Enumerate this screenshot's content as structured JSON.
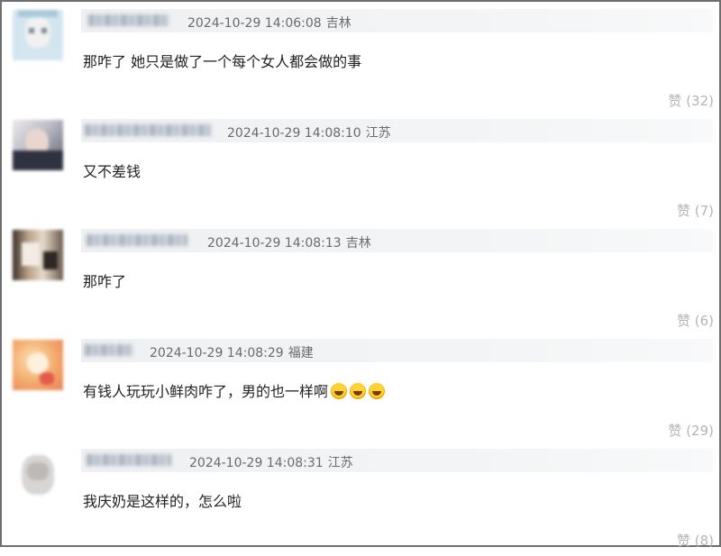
{
  "comments": [
    {
      "timestamp": "2024-10-29 14:06:08",
      "location": "吉林",
      "text": "那咋了 她只是做了一个每个女人都会做的事",
      "like_label": "赞",
      "like_count": "(32)",
      "emoji": []
    },
    {
      "timestamp": "2024-10-29 14:08:10",
      "location": "江苏",
      "text": "又不差钱",
      "like_label": "赞",
      "like_count": "(7)",
      "emoji": []
    },
    {
      "timestamp": "2024-10-29 14:08:13",
      "location": "吉林",
      "text": "那咋了",
      "like_label": "赞",
      "like_count": "(6)",
      "emoji": []
    },
    {
      "timestamp": "2024-10-29 14:08:29",
      "location": "福建",
      "text": "有钱人玩玩小鲜肉咋了，男的也一样啊",
      "like_label": "赞",
      "like_count": "(29)",
      "emoji": [
        "rolling-on-floor-laughing-icon",
        "rolling-on-floor-laughing-icon",
        "rolling-on-floor-laughing-icon"
      ]
    },
    {
      "timestamp": "2024-10-29 14:08:31",
      "location": "江苏",
      "text": "我庆奶是这样的，怎么啦",
      "like_label": "赞",
      "like_count": "(8)",
      "emoji": []
    }
  ],
  "colors": {
    "meta_bar": "#eef0f2",
    "meta_text": "#6b6b6b",
    "like_text": "#b5b5b5",
    "body_text": "#222222"
  }
}
